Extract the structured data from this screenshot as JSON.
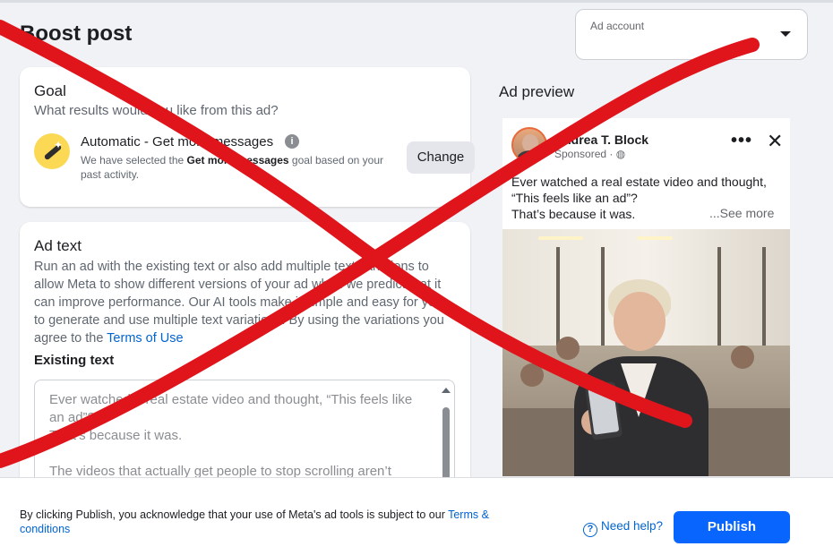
{
  "header": {
    "title": "Boost post",
    "ad_account_label": "Ad account"
  },
  "goal": {
    "title": "Goal",
    "subtitle": "What results would you like from this ad?",
    "option_name": "Automatic - Get more messages",
    "description_prefix": "We have selected the ",
    "description_bold": "Get more messages",
    "description_suffix": " goal based on your past activity.",
    "change_label": "Change",
    "icon": "magic-wand-icon"
  },
  "ad_text": {
    "title": "Ad text",
    "description": "Run an ad with the existing text or also add multiple text variations to allow Meta to show different versions of your ad when we predict that it can improve performance. Our AI tools make it simple and easy for you to generate and use multiple text variations. By using the variations you agree to the ",
    "terms_link": "Terms of Use",
    "existing_label": "Existing text",
    "existing_lines": [
      "Ever watched a real estate video and thought, “This feels like an ad”?",
      "That’s because it was.",
      "",
      "The videos that actually get people to stop scrolling aren’t"
    ]
  },
  "preview": {
    "label": "Ad preview",
    "page_name": "Andrea T. Block",
    "sponsored": "Sponsored",
    "text_lines": [
      "Ever watched a real estate video and thought,",
      "“This feels like an ad”?",
      "That’s because it was."
    ],
    "see_more": "...See more",
    "more_icon": "ellipsis-icon",
    "close_icon": "close-icon"
  },
  "footer": {
    "legal_text": "By clicking Publish, you acknowledge that your use of Meta's ad tools is subject to our ",
    "legal_link": "Terms & conditions",
    "help_label": "Need help?",
    "publish_label": "Publish"
  },
  "colors": {
    "accent": "#0866ff",
    "link": "#0064d1",
    "scribble": "#e0141b"
  }
}
